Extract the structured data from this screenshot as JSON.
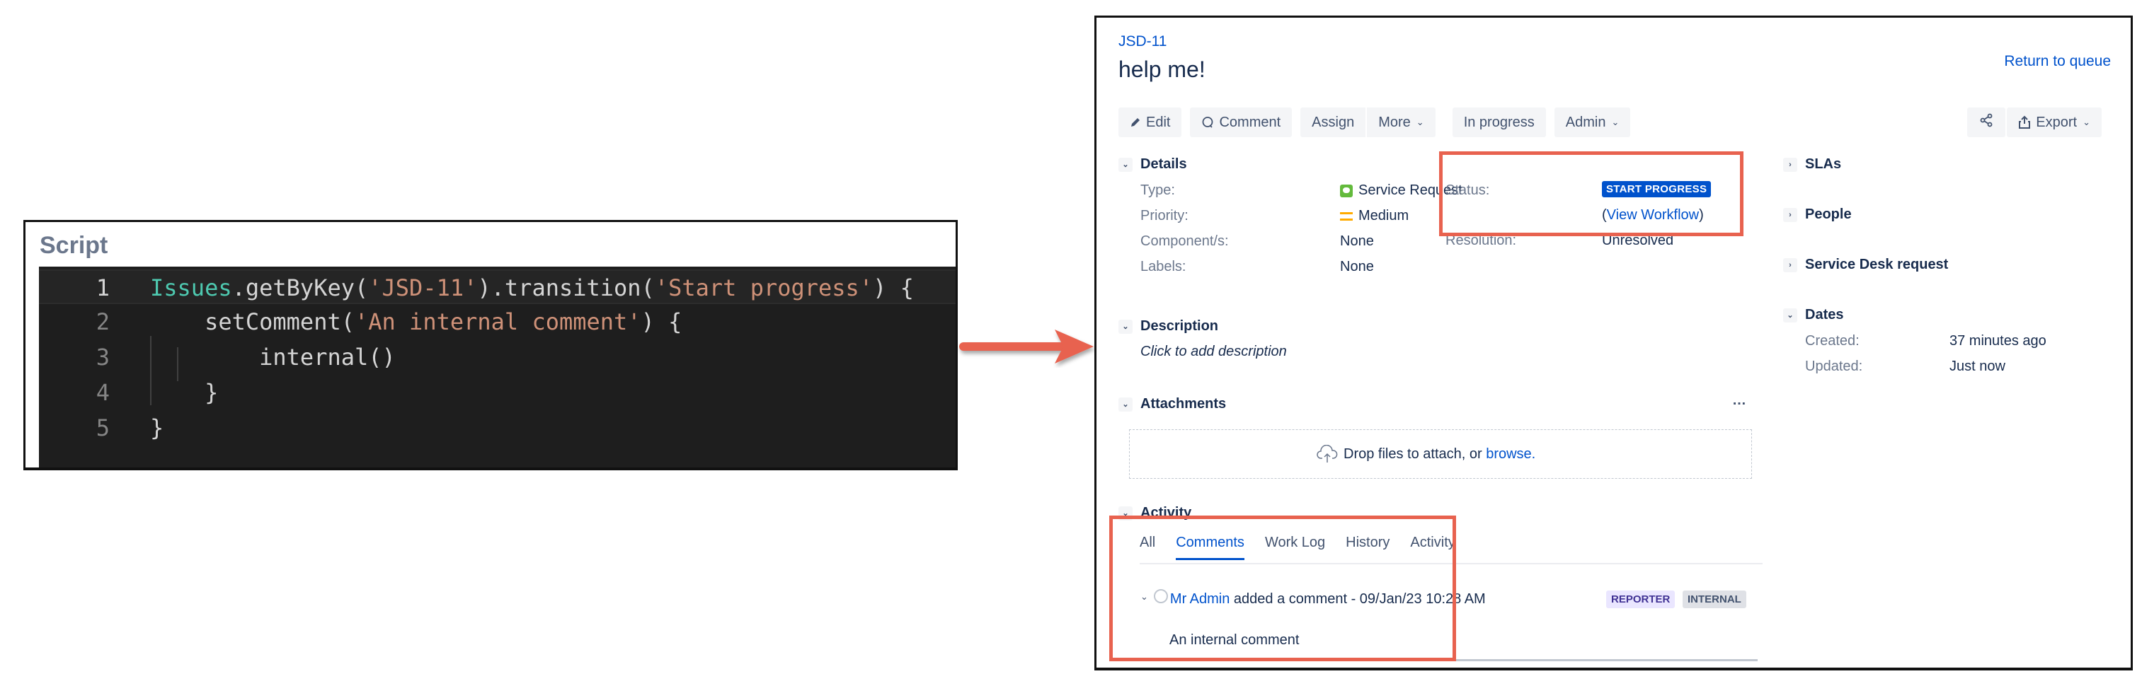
{
  "script_panel": {
    "title": "Script",
    "lines": [
      {
        "num": "1",
        "tokens": [
          {
            "text": "Issues",
            "type": "ident"
          },
          {
            "text": ".getByKey(",
            "type": "plain"
          },
          {
            "text": "'JSD-11'",
            "type": "str"
          },
          {
            "text": ").transition(",
            "type": "plain"
          },
          {
            "text": "'Start progress'",
            "type": "str"
          },
          {
            "text": ") {",
            "type": "plain"
          }
        ]
      },
      {
        "num": "2",
        "tokens": [
          {
            "text": "    setComment(",
            "type": "plain"
          },
          {
            "text": "'An internal comment'",
            "type": "str"
          },
          {
            "text": ") {",
            "type": "plain"
          }
        ]
      },
      {
        "num": "3",
        "tokens": [
          {
            "text": "        internal()",
            "type": "plain"
          }
        ]
      },
      {
        "num": "4",
        "tokens": [
          {
            "text": "    }",
            "type": "plain"
          }
        ]
      },
      {
        "num": "5",
        "tokens": [
          {
            "text": "}",
            "type": "plain"
          }
        ]
      }
    ]
  },
  "issue": {
    "key": "JSD-11",
    "title": "help me!",
    "return_link": "Return to queue",
    "toolbar": {
      "edit": "Edit",
      "comment": "Comment",
      "assign": "Assign",
      "more": "More",
      "in_progress": "In progress",
      "admin": "Admin",
      "export": "Export"
    },
    "details": {
      "heading": "Details",
      "type_label": "Type:",
      "type_value": "Service Request",
      "priority_label": "Priority:",
      "priority_value": "Medium",
      "components_label": "Component/s:",
      "components_value": "None",
      "labels_label": "Labels:",
      "labels_value": "None",
      "status_label": "Status:",
      "status_value": "START PROGRESS",
      "view_workflow_open": "(",
      "view_workflow": "View Workflow",
      "view_workflow_close": ")",
      "resolution_label": "Resolution:",
      "resolution_value": "Unresolved"
    },
    "side": {
      "slas": "SLAs",
      "people": "People",
      "service_desk_request": "Service Desk request",
      "dates": "Dates",
      "created_label": "Created:",
      "created_value": "37 minutes ago",
      "updated_label": "Updated:",
      "updated_value": "Just now"
    },
    "description": {
      "heading": "Description",
      "placeholder": "Click to add description"
    },
    "attachments": {
      "heading": "Attachments",
      "more": "…",
      "drop_text": "Drop files to attach, or ",
      "browse": "browse."
    },
    "activity": {
      "heading": "Activity",
      "tabs": [
        "All",
        "Comments",
        "Work Log",
        "History",
        "Activity"
      ],
      "active_tab": "Comments",
      "comment": {
        "author": "Mr Admin",
        "action": " added a comment - 09/Jan/23 10:28 AM",
        "badge_reporter": "REPORTER",
        "badge_internal": "INTERNAL",
        "body": "An internal comment"
      }
    }
  },
  "colors": {
    "highlight": "#e8624f",
    "link": "#0052cc",
    "status_lozenge": "#0052cc"
  }
}
